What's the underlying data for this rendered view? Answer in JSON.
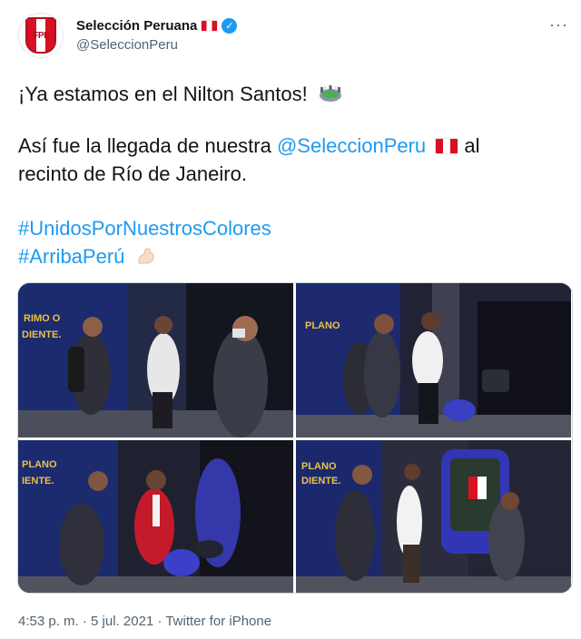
{
  "account": {
    "display_name": "Selección Peruana",
    "handle": "@SeleccionPeru",
    "avatar_icon": "fpf-crest-icon",
    "avatar_text": "FPF",
    "verified_icon": "verified-badge-icon",
    "flag_icon": "peru-flag-icon"
  },
  "menu_icon": "more-options-icon",
  "menu_glyph": "···",
  "verified_glyph": "✓",
  "tweet": {
    "line1": "¡Ya estamos en el Nilton Santos!",
    "line2_pre": "Así fue la llegada de nuestra ",
    "line2_mention": "@SeleccionPeru",
    "line2_post": " al",
    "line3": "recinto de Río de Janeiro.",
    "hashtag1": "#UnidosPorNuestrosColores",
    "hashtag2": "#ArribaPerú"
  },
  "media": {
    "photo_count": 4,
    "photos": [
      {
        "label": "team-arrival-photo-1"
      },
      {
        "label": "team-arrival-photo-2"
      },
      {
        "label": "team-arrival-photo-3"
      },
      {
        "label": "team-arrival-photo-4"
      }
    ]
  },
  "footer": {
    "time": "4:53 p. m.",
    "sep1": " · ",
    "date": "5 jul. 2021",
    "sep2": " · ",
    "client": "Twitter for iPhone"
  },
  "colors": {
    "link": "#1d9bf0",
    "text": "#0f1419",
    "secondary": "#536471",
    "peru_red": "#d91023"
  }
}
